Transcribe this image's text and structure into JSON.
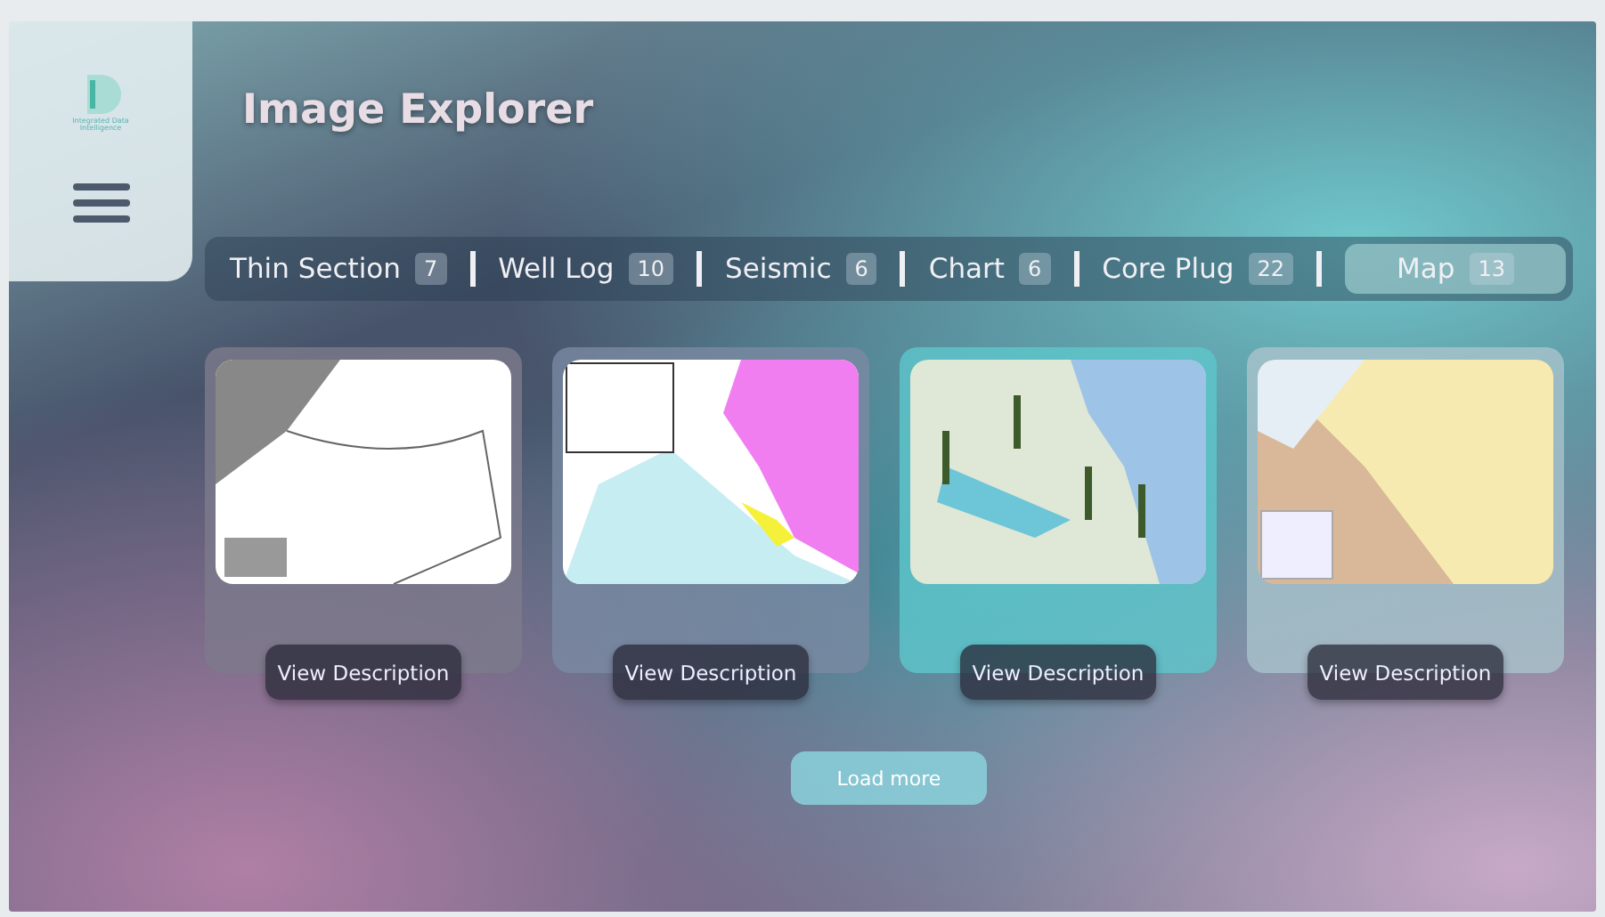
{
  "logo": {
    "text": "Integrated Data Intelligence"
  },
  "title": "Image Explorer",
  "tabs": [
    {
      "label": "Thin Section",
      "count": "7",
      "selected": false
    },
    {
      "label": "Well Log",
      "count": "10",
      "selected": false
    },
    {
      "label": "Seismic",
      "count": "6",
      "selected": false
    },
    {
      "label": "Chart",
      "count": "6",
      "selected": false
    },
    {
      "label": "Core Plug",
      "count": "22",
      "selected": false
    },
    {
      "label": "Map",
      "count": "13",
      "selected": true
    }
  ],
  "cards": [
    {
      "button": "View Description",
      "color": "#7d7a8c"
    },
    {
      "button": "View Description",
      "color": "#7b8aa2"
    },
    {
      "button": "View Description",
      "color": "#5ec7cc"
    },
    {
      "button": "View Description",
      "color": "#a9c3cc"
    }
  ],
  "load_more": "Load more"
}
